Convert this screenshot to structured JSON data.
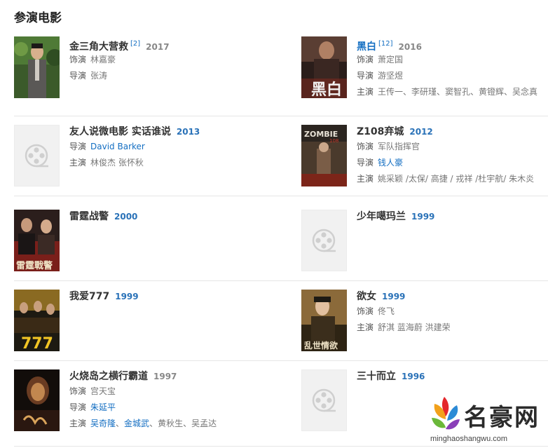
{
  "section_title": "参演电影",
  "rows": [
    {
      "left": {
        "title": "金三角大营救",
        "title_link": false,
        "sup": "[2]",
        "year": "2017",
        "year_style": "gray",
        "meta": [
          {
            "label": "饰演",
            "parts": [
              {
                "text": "林嘉豪",
                "link": false
              }
            ]
          },
          {
            "label": "导演",
            "parts": [
              {
                "text": "张涛",
                "link": false
              }
            ]
          }
        ]
      },
      "right": {
        "title": "黑白",
        "title_link": true,
        "sup": "[12]",
        "year": "2016",
        "year_style": "gray",
        "meta": [
          {
            "label": "饰演",
            "parts": [
              {
                "text": "萧定国",
                "link": false
              }
            ]
          },
          {
            "label": "导演",
            "parts": [
              {
                "text": "游坚煜",
                "link": false
              }
            ]
          },
          {
            "label": "主演",
            "parts": [
              {
                "text": "王传一、李研瑾、窦智孔、黄镫辉、吴念真",
                "link": false
              }
            ]
          }
        ]
      }
    },
    {
      "left": {
        "title": "友人说微电影 实话谁说",
        "title_link": false,
        "sup": "",
        "year": "2013",
        "year_style": "blue",
        "meta": [
          {
            "label": "导演",
            "parts": [
              {
                "text": "David Barker",
                "link": true
              }
            ]
          },
          {
            "label": "主演",
            "parts": [
              {
                "text": "林俊杰 张怀秋",
                "link": false
              }
            ]
          }
        ]
      },
      "right": {
        "title": "Z108弃城",
        "title_link": false,
        "sup": "",
        "year": "2012",
        "year_style": "blue",
        "meta": [
          {
            "label": "饰演",
            "parts": [
              {
                "text": "军队指挥官",
                "link": false
              }
            ]
          },
          {
            "label": "导演",
            "parts": [
              {
                "text": "钱人豪",
                "link": true
              }
            ]
          },
          {
            "label": "主演",
            "parts": [
              {
                "text": "姚采颖 /太保/ 高捷 / 戎祥 /杜宇航/ 朱木炎",
                "link": false
              }
            ]
          }
        ]
      }
    },
    {
      "left": {
        "title": "雷霆战警",
        "title_link": false,
        "sup": "",
        "year": "2000",
        "year_style": "blue",
        "meta": []
      },
      "right": {
        "title": "少年噶玛兰",
        "title_link": false,
        "sup": "",
        "year": "1999",
        "year_style": "blue",
        "meta": []
      }
    },
    {
      "left": {
        "title": "我爱777",
        "title_link": false,
        "sup": "",
        "year": "1999",
        "year_style": "blue",
        "meta": []
      },
      "right": {
        "title": "欲女",
        "title_link": false,
        "sup": "",
        "year": "1999",
        "year_style": "blue",
        "meta": [
          {
            "label": "饰演",
            "parts": [
              {
                "text": "佟飞",
                "link": false
              }
            ]
          },
          {
            "label": "主演",
            "parts": [
              {
                "text": "舒淇 蓝海蔚 洪建荣",
                "link": false
              }
            ]
          }
        ]
      }
    },
    {
      "left": {
        "title": "火烧岛之横行霸道",
        "title_link": false,
        "sup": "",
        "year": "1997",
        "year_style": "gray",
        "meta": [
          {
            "label": "饰演",
            "parts": [
              {
                "text": "宫天宝",
                "link": false
              }
            ]
          },
          {
            "label": "导演",
            "parts": [
              {
                "text": "朱延平",
                "link": true
              }
            ]
          },
          {
            "label": "主演",
            "parts": [
              {
                "text": "吴奇隆",
                "link": true
              },
              {
                "text": "、",
                "link": false
              },
              {
                "text": "金城武",
                "link": true
              },
              {
                "text": "、黄秋生、吴孟达",
                "link": false
              }
            ]
          }
        ]
      },
      "right": {
        "title": "三十而立",
        "title_link": false,
        "sup": "",
        "year": "1996",
        "year_style": "blue",
        "meta": []
      }
    }
  ],
  "poster_texts": {
    "heibai": "黑白",
    "zombie": "ZOMBIE",
    "zombie_sub": "108",
    "leiting": "雷霆戰警",
    "seven": "777",
    "yunu": "乱世情欲"
  },
  "watermark": {
    "name": "名豪网",
    "url": "minghaoshangwu.com"
  }
}
